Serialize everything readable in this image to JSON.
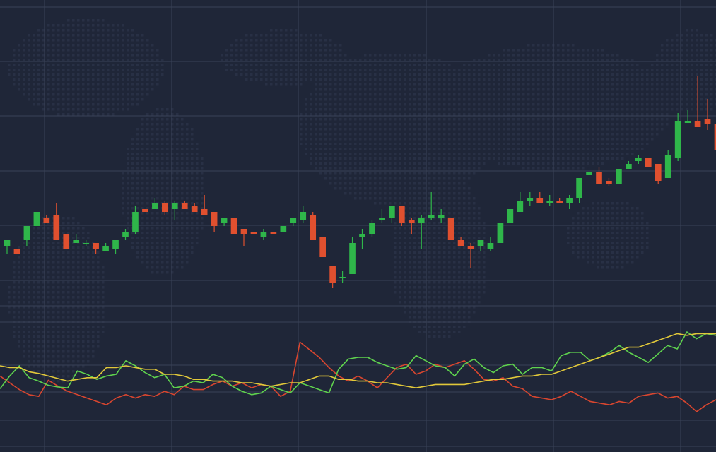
{
  "colors": {
    "background": "#1f2638",
    "grid": "#3a4257",
    "map_dots": "#283045",
    "bull": "#2fb64a",
    "bear": "#e0502f",
    "osc_green": "#5fd34e",
    "osc_yellow": "#e1c83a",
    "osc_red": "#d9462f"
  },
  "chart_data": [
    {
      "type": "candlestick",
      "title": "",
      "xlabel": "",
      "ylabel": "",
      "grid": true,
      "ylim": [
        0,
        100
      ],
      "candles": [
        {
          "o": 18,
          "h": 20,
          "l": 15,
          "c": 20
        },
        {
          "o": 17,
          "h": 17,
          "l": 16,
          "c": 15
        },
        {
          "o": 20,
          "h": 21,
          "l": 18,
          "c": 25
        },
        {
          "o": 25,
          "h": 27,
          "l": 25,
          "c": 30
        },
        {
          "o": 28,
          "h": 29,
          "l": 26,
          "c": 26
        },
        {
          "o": 29,
          "h": 33,
          "l": 21,
          "c": 20
        },
        {
          "o": 22,
          "h": 22,
          "l": 17,
          "c": 17
        },
        {
          "o": 19,
          "h": 22,
          "l": 19,
          "c": 20
        },
        {
          "o": 19,
          "h": 20,
          "l": 18,
          "c": 19
        },
        {
          "o": 19,
          "h": 19,
          "l": 15,
          "c": 17
        },
        {
          "o": 16,
          "h": 19,
          "l": 16,
          "c": 18
        },
        {
          "o": 17,
          "h": 20,
          "l": 15,
          "c": 20
        },
        {
          "o": 21,
          "h": 24,
          "l": 20,
          "c": 23
        },
        {
          "o": 23,
          "h": 32,
          "l": 22,
          "c": 30
        },
        {
          "o": 31,
          "h": 31,
          "l": 30,
          "c": 30
        },
        {
          "o": 31,
          "h": 35,
          "l": 31,
          "c": 33
        },
        {
          "o": 33,
          "h": 34,
          "l": 29,
          "c": 30
        },
        {
          "o": 31,
          "h": 34,
          "l": 27,
          "c": 33
        },
        {
          "o": 33,
          "h": 34,
          "l": 31,
          "c": 31
        },
        {
          "o": 32,
          "h": 33,
          "l": 30,
          "c": 30
        },
        {
          "o": 31,
          "h": 36,
          "l": 29,
          "c": 29
        },
        {
          "o": 30,
          "h": 30,
          "l": 23,
          "c": 25
        },
        {
          "o": 26,
          "h": 28,
          "l": 25,
          "c": 28
        },
        {
          "o": 28,
          "h": 28,
          "l": 22,
          "c": 22
        },
        {
          "o": 24,
          "h": 24,
          "l": 18,
          "c": 22
        },
        {
          "o": 23,
          "h": 23,
          "l": 22,
          "c": 22
        },
        {
          "o": 21,
          "h": 24,
          "l": 20,
          "c": 23
        },
        {
          "o": 23,
          "h": 23,
          "l": 22,
          "c": 22
        },
        {
          "o": 23,
          "h": 25,
          "l": 23,
          "c": 25
        },
        {
          "o": 26,
          "h": 28,
          "l": 25,
          "c": 28
        },
        {
          "o": 27,
          "h": 32,
          "l": 26,
          "c": 30
        },
        {
          "o": 29,
          "h": 30,
          "l": 20,
          "c": 20
        },
        {
          "o": 21,
          "h": 21,
          "l": 14,
          "c": 14
        },
        {
          "o": 11,
          "h": 11,
          "l": 3,
          "c": 5
        },
        {
          "o": 7,
          "h": 9,
          "l": 5,
          "c": 7
        },
        {
          "o": 8,
          "h": 21,
          "l": 8,
          "c": 19
        },
        {
          "o": 21,
          "h": 24,
          "l": 17,
          "c": 22
        },
        {
          "o": 22,
          "h": 27,
          "l": 21,
          "c": 26
        },
        {
          "o": 27,
          "h": 31,
          "l": 26,
          "c": 28
        },
        {
          "o": 28,
          "h": 32,
          "l": 26,
          "c": 32
        },
        {
          "o": 32,
          "h": 32,
          "l": 25,
          "c": 26
        },
        {
          "o": 27,
          "h": 28,
          "l": 22,
          "c": 26
        },
        {
          "o": 26,
          "h": 29,
          "l": 17,
          "c": 28
        },
        {
          "o": 28,
          "h": 37,
          "l": 27,
          "c": 29
        },
        {
          "o": 28,
          "h": 31,
          "l": 26,
          "c": 29
        },
        {
          "o": 28,
          "h": 28,
          "l": 20,
          "c": 20
        },
        {
          "o": 20,
          "h": 21,
          "l": 18,
          "c": 18
        },
        {
          "o": 18,
          "h": 19,
          "l": 10,
          "c": 17
        },
        {
          "o": 18,
          "h": 20,
          "l": 16,
          "c": 20
        },
        {
          "o": 17,
          "h": 21,
          "l": 16,
          "c": 19
        },
        {
          "o": 19,
          "h": 26,
          "l": 19,
          "c": 26
        },
        {
          "o": 26,
          "h": 30,
          "l": 26,
          "c": 31
        },
        {
          "o": 30,
          "h": 37,
          "l": 30,
          "c": 34
        },
        {
          "o": 34,
          "h": 37,
          "l": 32,
          "c": 35
        },
        {
          "o": 35,
          "h": 37,
          "l": 33,
          "c": 33
        },
        {
          "o": 33,
          "h": 36,
          "l": 32,
          "c": 34
        },
        {
          "o": 34,
          "h": 35,
          "l": 33,
          "c": 33
        },
        {
          "o": 33,
          "h": 36,
          "l": 31,
          "c": 35
        },
        {
          "o": 35,
          "h": 42,
          "l": 33,
          "c": 42
        },
        {
          "o": 43,
          "h": 44,
          "l": 43,
          "c": 44
        },
        {
          "o": 44,
          "h": 46,
          "l": 40,
          "c": 40
        },
        {
          "o": 41,
          "h": 42,
          "l": 39,
          "c": 40
        },
        {
          "o": 40,
          "h": 45,
          "l": 40,
          "c": 45
        },
        {
          "o": 45,
          "h": 48,
          "l": 45,
          "c": 47
        },
        {
          "o": 48,
          "h": 50,
          "l": 47,
          "c": 49
        },
        {
          "o": 49,
          "h": 49,
          "l": 47,
          "c": 46
        },
        {
          "o": 47,
          "h": 47,
          "l": 40,
          "c": 41
        },
        {
          "o": 42,
          "h": 52,
          "l": 42,
          "c": 50
        },
        {
          "o": 49,
          "h": 65,
          "l": 48,
          "c": 62
        },
        {
          "o": 62,
          "h": 66,
          "l": 62,
          "c": 62
        },
        {
          "o": 62,
          "h": 78,
          "l": 61,
          "c": 60
        },
        {
          "o": 63,
          "h": 70,
          "l": 59,
          "c": 61
        },
        {
          "o": 61,
          "h": 61,
          "l": 52,
          "c": 52
        }
      ]
    },
    {
      "type": "line",
      "title": "",
      "xlabel": "",
      "ylabel": "",
      "grid": true,
      "ylim": [
        0,
        100
      ],
      "series": [
        {
          "color": "#d9462f",
          "values": [
            48,
            40,
            32,
            26,
            24,
            43,
            36,
            30,
            26,
            22,
            18,
            14,
            22,
            26,
            22,
            26,
            24,
            30,
            26,
            36,
            32,
            32,
            38,
            42,
            36,
            40,
            34,
            38,
            36,
            24,
            30,
            88,
            79,
            70,
            58,
            48,
            42,
            48,
            42,
            34,
            46,
            58,
            62,
            50,
            54,
            62,
            58,
            62,
            66,
            56,
            44,
            42,
            46,
            36,
            33,
            24,
            22,
            20,
            24,
            30,
            24,
            18,
            16,
            14,
            18,
            16,
            24,
            26,
            28,
            22,
            24,
            16,
            6,
            14,
            20
          ]
        },
        {
          "color": "#5fd34e",
          "values": [
            33,
            48,
            60,
            46,
            42,
            37,
            35,
            34,
            54,
            50,
            44,
            48,
            50,
            66,
            60,
            52,
            46,
            50,
            34,
            36,
            42,
            40,
            50,
            46,
            36,
            30,
            26,
            28,
            36,
            32,
            28,
            40,
            36,
            32,
            28,
            56,
            68,
            70,
            70,
            64,
            60,
            56,
            58,
            72,
            66,
            60,
            58,
            48,
            62,
            68,
            58,
            52,
            60,
            62,
            50,
            58,
            58,
            54,
            72,
            76,
            76,
            66,
            70,
            76,
            84,
            76,
            70,
            64,
            74,
            84,
            80,
            100,
            92,
            98,
            96
          ]
        },
        {
          "color": "#e1c83a",
          "values": [
            60,
            58,
            58,
            53,
            51,
            48,
            45,
            42,
            44,
            46,
            46,
            58,
            58,
            60,
            58,
            56,
            56,
            50,
            50,
            48,
            44,
            44,
            42,
            42,
            42,
            40,
            40,
            38,
            36,
            38,
            40,
            40,
            44,
            48,
            48,
            44,
            44,
            42,
            42,
            40,
            40,
            38,
            36,
            34,
            36,
            38,
            38,
            38,
            38,
            40,
            42,
            44,
            44,
            46,
            48,
            48,
            50,
            50,
            54,
            58,
            62,
            66,
            70,
            74,
            78,
            82,
            82,
            86,
            90,
            94,
            98,
            96,
            98,
            98,
            98
          ]
        }
      ]
    }
  ]
}
